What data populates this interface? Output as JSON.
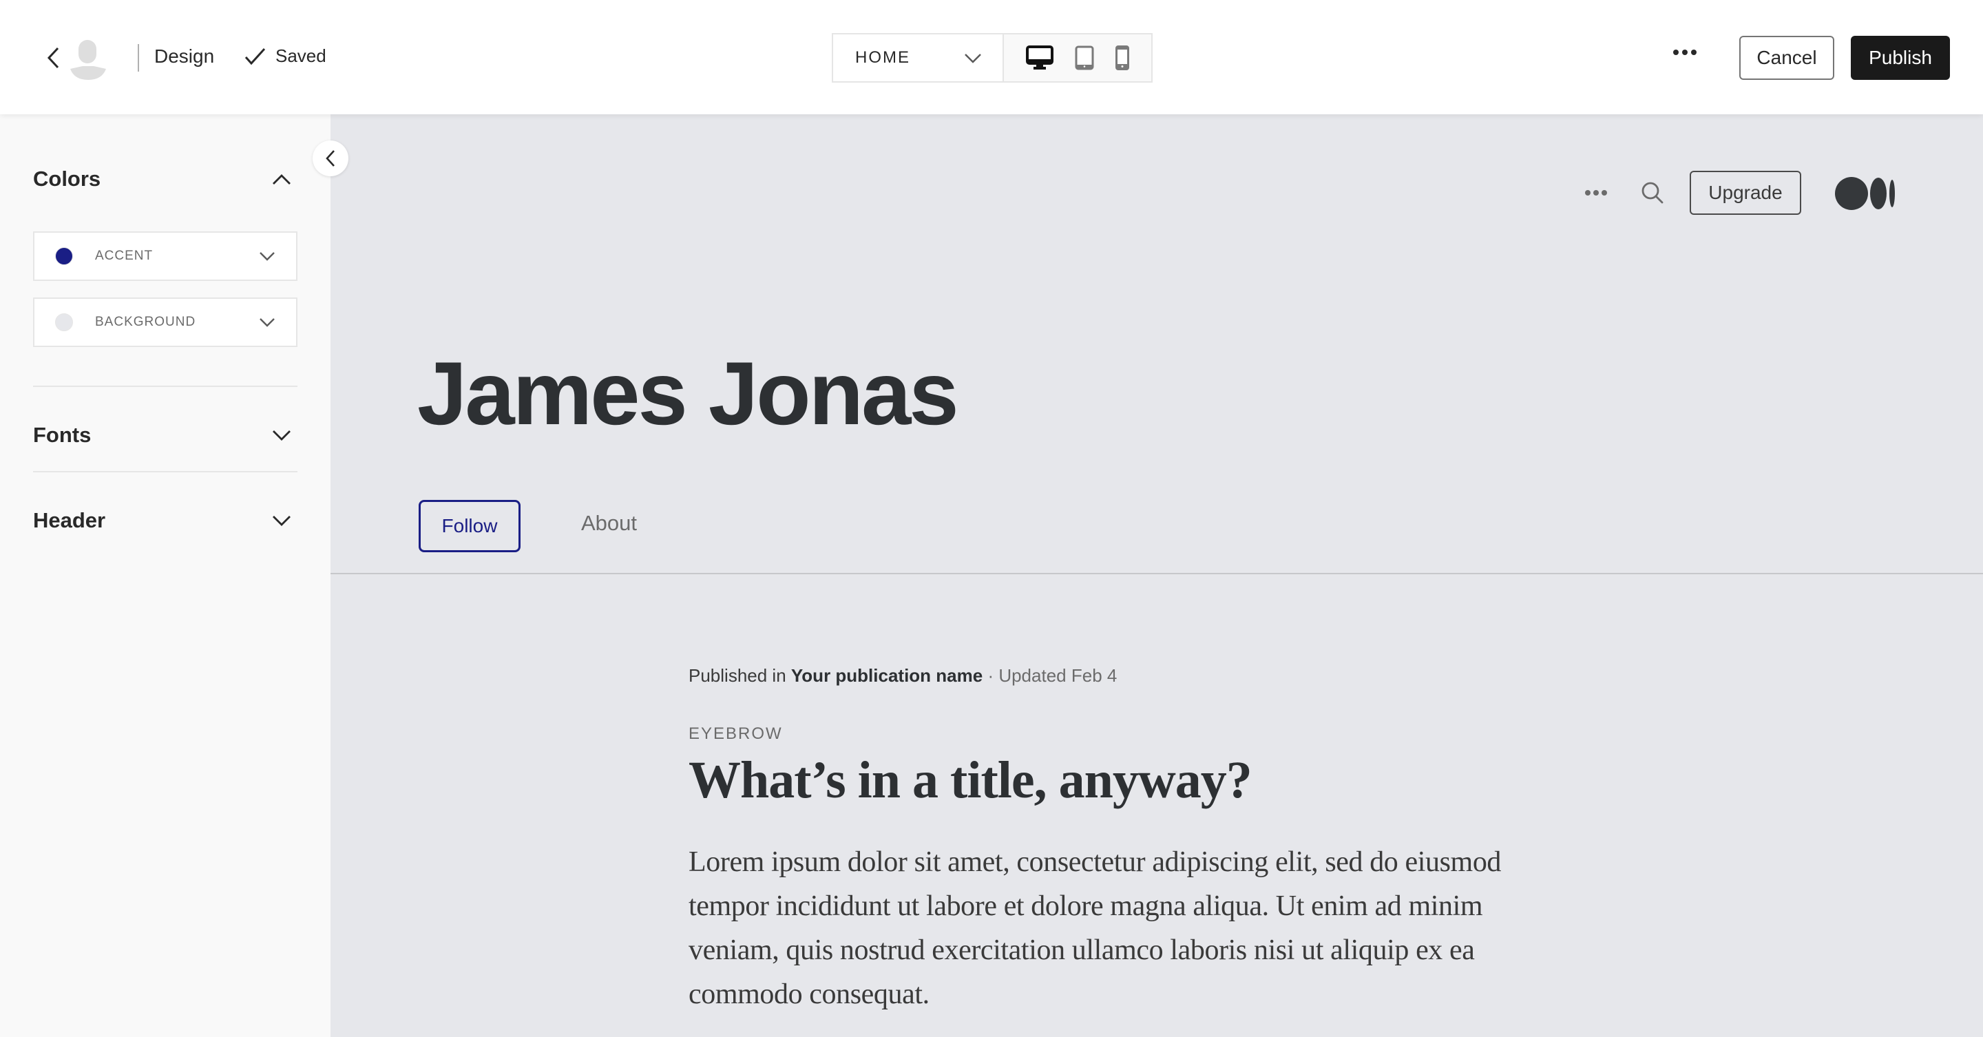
{
  "topbar": {
    "section_label": "Design",
    "status_label": "Saved",
    "page_select": {
      "selected": "HOME"
    },
    "devices": [
      {
        "name": "desktop",
        "active": true
      },
      {
        "name": "tablet",
        "active": false
      },
      {
        "name": "mobile",
        "active": false
      }
    ],
    "cancel_label": "Cancel",
    "publish_label": "Publish"
  },
  "sidebar": {
    "sections": [
      {
        "title": "Colors",
        "expanded": true
      },
      {
        "title": "Fonts",
        "expanded": false
      },
      {
        "title": "Header",
        "expanded": false
      }
    ],
    "colors": [
      {
        "label": "ACCENT",
        "color": "#1a1e85"
      },
      {
        "label": "BACKGROUND",
        "color": "#e6e7eb"
      }
    ]
  },
  "preview": {
    "upgrade_label": "Upgrade",
    "author_name": "James Jonas",
    "follow_label": "Follow",
    "about_label": "About",
    "post": {
      "published_prefix": "Published in ",
      "publication_name": "Your publication name",
      "updated": " · Updated Feb 4",
      "eyebrow": "EYEBROW",
      "title": "What’s in a title, anyway?",
      "body": "Lorem ipsum dolor sit amet, consectetur adipiscing elit, sed do eiusmod tempor incididunt ut labore et dolore magna aliqua. Ut enim ad minim veniam, quis nostrud exercitation ullamco laboris nisi ut aliquip ex ea commodo consequat."
    }
  },
  "colors": {
    "accent": "#1a1e85",
    "publish_bg": "#1a1a1a",
    "preview_bg": "#e6e7eb",
    "sidebar_bg": "#f9f9f9"
  }
}
